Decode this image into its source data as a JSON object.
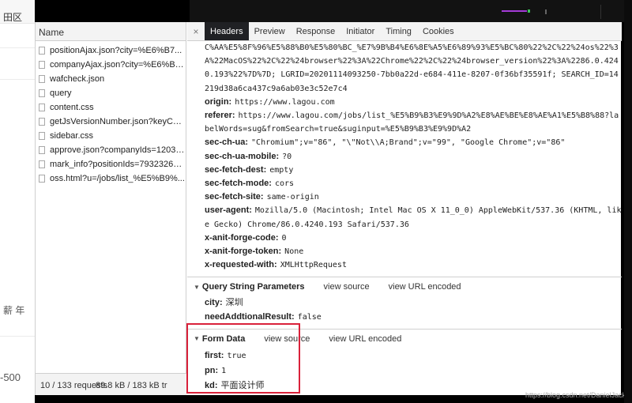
{
  "background": {
    "top_fragment": "田区",
    "mid_fragment": "薪 年",
    "bottom_fragment": "-500"
  },
  "network": {
    "column_header": "Name",
    "requests": [
      "positionAjax.json?city=%E6%B7...",
      "companyAjax.json?city=%E6%B7...",
      "wafcheck.json",
      "query",
      "content.css",
      "getJsVersionNumber.json?keyCod...",
      "sidebar.css",
      "approve.json?companyIds=12035...",
      "mark_info?positionIds=7932326%...",
      "oss.html?u=/jobs/list_%E5%B9%..."
    ],
    "status_requests": "10 / 133 requests",
    "status_size": "89.8 kB / 183 kB tr"
  },
  "tabs": {
    "close": "×",
    "items": [
      "Headers",
      "Preview",
      "Response",
      "Initiator",
      "Timing",
      "Cookies"
    ],
    "active": "Headers"
  },
  "headers": {
    "cookie_tail": "C%AA%E5%8F%96%E5%88%B0%E5%80%BC_%E7%9B%B4%E6%8E%A5%E6%89%93%E5%BC%80%22%2C%22%24os%22%3A%22MacOS%22%2C%22%24browser%22%3A%22Chrome%22%2C%22%24browser_version%22%3A%2286.0.4240.193%22%7D%7D; LGRID=20201114093250-7bb0a22d-e684-411e-8207-0f36bf35591f; SEARCH_ID=14219d38a6ca437c9a6ab03e3c52e7c4",
    "origin": {
      "key": "origin:",
      "value": "https://www.lagou.com"
    },
    "referer": {
      "key": "referer:",
      "value": "https://www.lagou.com/jobs/list_%E5%B9%B3%E9%9D%A2%E8%AE%BE%E8%AE%A1%E5%B8%88?labelWords=sug&fromSearch=true&suginput=%E5%B9%B3%E9%9D%A2"
    },
    "sec_ch_ua": {
      "key": "sec-ch-ua:",
      "value": "\"Chromium\";v=\"86\", \"\\\"Not\\\\A;Brand\";v=\"99\", \"Google Chrome\";v=\"86\""
    },
    "sec_ch_ua_mobile": {
      "key": "sec-ch-ua-mobile:",
      "value": "?0"
    },
    "sec_fetch_dest": {
      "key": "sec-fetch-dest:",
      "value": "empty"
    },
    "sec_fetch_mode": {
      "key": "sec-fetch-mode:",
      "value": "cors"
    },
    "sec_fetch_site": {
      "key": "sec-fetch-site:",
      "value": "same-origin"
    },
    "user_agent": {
      "key": "user-agent:",
      "value": "Mozilla/5.0 (Macintosh; Intel Mac OS X 11_0_0) AppleWebKit/537.36 (KHTML, like Gecko) Chrome/86.0.4240.193 Safari/537.36"
    },
    "x_anit_forge_code": {
      "key": "x-anit-forge-code:",
      "value": "0"
    },
    "x_anit_forge_token": {
      "key": "x-anit-forge-token:",
      "value": "None"
    },
    "x_requested_with": {
      "key": "x-requested-with:",
      "value": "XMLHttpRequest"
    }
  },
  "query_string": {
    "title": "Query String Parameters",
    "view_source": "view source",
    "view_url_encoded": "view URL encoded",
    "params": [
      {
        "key": "city:",
        "value": "深圳"
      },
      {
        "key": "needAddtionalResult:",
        "value": "false"
      }
    ]
  },
  "form_data": {
    "title": "Form Data",
    "view_source": "view source",
    "view_url_encoded": "view URL encoded",
    "params": [
      {
        "key": "first:",
        "value": "true"
      },
      {
        "key": "pn:",
        "value": "1"
      },
      {
        "key": "kd:",
        "value": "平面设计师"
      }
    ]
  },
  "watermark": "https://blog.csdn.net/DanielJackZ",
  "colors": {
    "highlight_box": "#d9213a",
    "active_tab": "#202124"
  }
}
